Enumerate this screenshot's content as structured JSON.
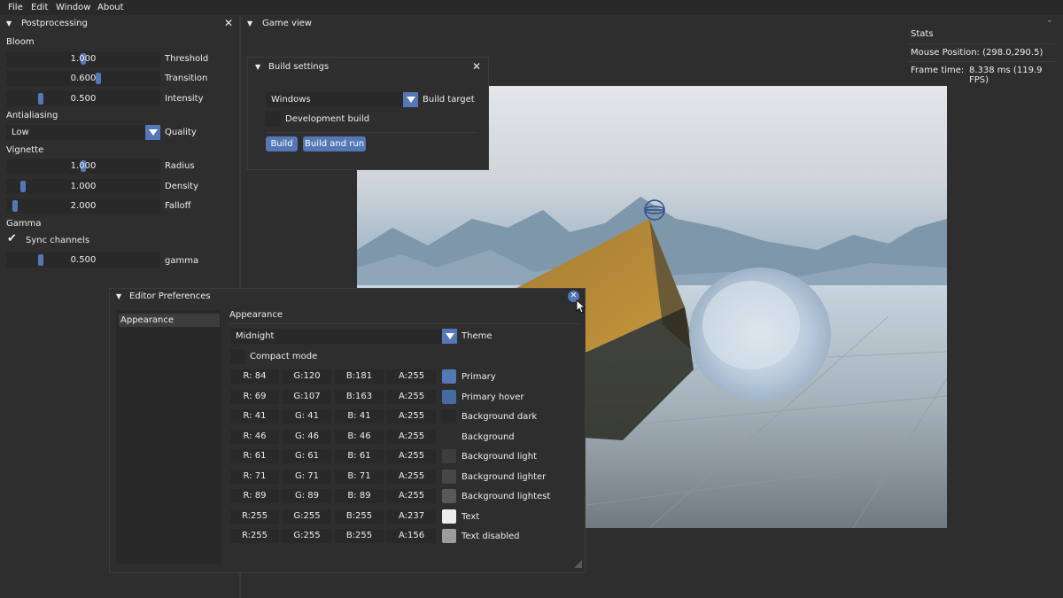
{
  "menu": [
    "File",
    "Edit",
    "Window",
    "About"
  ],
  "postprocessing": {
    "title": "Postprocessing",
    "bloom": {
      "header": "Bloom",
      "rows": [
        {
          "value": "1.000",
          "label": "Threshold",
          "level": 0.5
        },
        {
          "value": "0.600",
          "label": "Transition",
          "level": 0.6
        },
        {
          "value": "0.500",
          "label": "Intensity",
          "level": 0.22
        }
      ]
    },
    "antialiasing": {
      "header": "Antialiasing",
      "value": "Low",
      "label": "Quality"
    },
    "vignette": {
      "header": "Vignette",
      "rows": [
        {
          "value": "1.000",
          "label": "Radius",
          "level": 0.5
        },
        {
          "value": "1.000",
          "label": "Density",
          "level": 0.1
        },
        {
          "value": "2.000",
          "label": "Falloff",
          "level": 0.05
        }
      ]
    },
    "gamma": {
      "header": "Gamma",
      "sync_label": "Sync channels",
      "sync_checked": true,
      "value": "0.500",
      "label": "gamma",
      "level": 0.22
    }
  },
  "game_view": {
    "title": "Game view"
  },
  "stats": {
    "title": "Stats",
    "mouse_position": "Mouse Position: (298.0,290.5)",
    "frame_time_label": "Frame time:",
    "frame_time_value": "8.338 ms (119.9 FPS)"
  },
  "build_settings": {
    "title": "Build settings",
    "target_value": "Windows",
    "target_label": "Build target",
    "dev_build_label": "Development build",
    "build_button": "Build",
    "build_run_button": "Build and run"
  },
  "editor_prefs": {
    "title": "Editor Preferences",
    "sidebar_item": "Appearance",
    "section": "Appearance",
    "theme_value": "Midnight",
    "theme_label": "Theme",
    "compact_label": "Compact mode",
    "colors": [
      {
        "r": "R: 84",
        "g": "G:120",
        "b": "B:181",
        "a": "A:255",
        "name": "Primary",
        "hex": "#5478b5"
      },
      {
        "r": "R: 69",
        "g": "G:107",
        "b": "B:163",
        "a": "A:255",
        "name": "Primary hover",
        "hex": "#456ba3"
      },
      {
        "r": "R: 41",
        "g": "G: 41",
        "b": "B: 41",
        "a": "A:255",
        "name": "Background dark",
        "hex": "#292929"
      },
      {
        "r": "R: 46",
        "g": "G: 46",
        "b": "B: 46",
        "a": "A:255",
        "name": "Background",
        "hex": "#2e2e2e"
      },
      {
        "r": "R: 61",
        "g": "G: 61",
        "b": "B: 61",
        "a": "A:255",
        "name": "Background light",
        "hex": "#3d3d3d"
      },
      {
        "r": "R: 71",
        "g": "G: 71",
        "b": "B: 71",
        "a": "A:255",
        "name": "Background lighter",
        "hex": "#474747"
      },
      {
        "r": "R: 89",
        "g": "G: 89",
        "b": "B: 89",
        "a": "A:255",
        "name": "Background lightest",
        "hex": "#595959"
      },
      {
        "r": "R:255",
        "g": "G:255",
        "b": "B:255",
        "a": "A:237",
        "name": "Text",
        "hex": "#ededed"
      },
      {
        "r": "R:255",
        "g": "G:255",
        "b": "B:255",
        "a": "A:156",
        "name": "Text disabled",
        "hex": "#9c9c9c"
      }
    ]
  },
  "theme_colors": {
    "accent": "#5478b5",
    "bg": "#2e2e2e",
    "bg_dark": "#292929",
    "text": "#ededed"
  }
}
